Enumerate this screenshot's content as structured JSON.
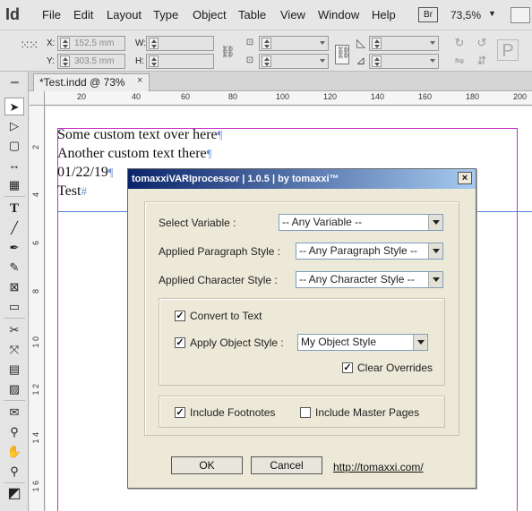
{
  "app": {
    "logo": "Id",
    "menu": [
      "File",
      "Edit",
      "Layout",
      "Type",
      "Object",
      "Table",
      "View",
      "Window",
      "Help"
    ],
    "bridge_badge": "Br",
    "zoom": "73,5%"
  },
  "controlbar": {
    "x_label": "X:",
    "x_value": "152,5 mm",
    "y_label": "Y:",
    "y_value": "303,5 mm",
    "w_label": "W:",
    "h_label": "H:"
  },
  "tab": {
    "title": "*Test.indd @ 73%",
    "close": "×"
  },
  "rulers": {
    "top": [
      "20",
      "40",
      "60",
      "80",
      "100",
      "120",
      "140",
      "160",
      "180",
      "200",
      "220"
    ],
    "left": [
      "2",
      "4",
      "6",
      "8",
      "1 0",
      "1 2",
      "1 4",
      "1 6"
    ]
  },
  "document": {
    "lines": [
      "Some custom text over here",
      "Another custom text there",
      "01/22/19",
      "Test"
    ],
    "pilcrow": "¶",
    "end_mark": "#"
  },
  "dialog": {
    "title": "tomaxxiVARIprocessor | 1.0.5 | by tomaxxi™",
    "close": "×",
    "select_variable_label": "Select Variable :",
    "select_variable_value": "-- Any Variable --",
    "paragraph_style_label": "Applied Paragraph Style :",
    "paragraph_style_value": "-- Any Paragraph Style --",
    "character_style_label": "Applied Character Style :",
    "character_style_value": "-- Any Character Style --",
    "convert_to_text": {
      "label": "Convert to Text",
      "checked": true
    },
    "apply_object_style": {
      "label": "Apply Object Style :",
      "checked": true
    },
    "object_style_value": "My Object Style",
    "clear_overrides": {
      "label": "Clear Overrides",
      "checked": true
    },
    "include_footnotes": {
      "label": "Include Footnotes",
      "checked": true
    },
    "include_master_pages": {
      "label": "Include Master Pages",
      "checked": false
    },
    "ok": "OK",
    "cancel": "Cancel",
    "link": "http://tomaxxi.com/"
  }
}
